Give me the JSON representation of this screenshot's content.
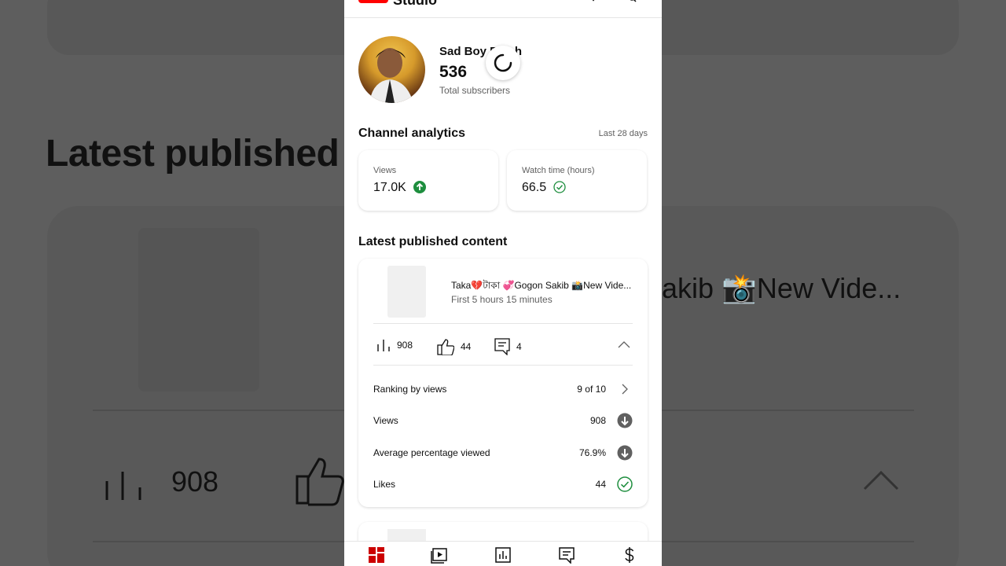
{
  "background": {
    "title": "Latest published",
    "video_title": "akib 📸New Vide...",
    "views": "908"
  },
  "appbar": {
    "brand": "Studio"
  },
  "channel": {
    "name": "Sad Boy R esh",
    "subscribers": "536",
    "subscribers_label": "Total subscribers"
  },
  "analytics": {
    "title": "Channel analytics",
    "period": "Last 28 days",
    "views_label": "Views",
    "views_value": "17.0K",
    "watch_label": "Watch time (hours)",
    "watch_value": "66.5"
  },
  "latest": {
    "title": "Latest published content",
    "video_title": "Taka💔টাকা 💞Gogon Sakib 📸New Vide...",
    "video_subtitle": "First 5 hours 15 minutes",
    "views": "908",
    "likes": "44",
    "comments": "4",
    "rows": [
      {
        "label": "Ranking by views",
        "value": "9 of 10",
        "icon": "chevron-right-icon"
      },
      {
        "label": "Views",
        "value": "908",
        "icon": "arrow-down-circle-icon"
      },
      {
        "label": "Average percentage viewed",
        "value": "76.9%",
        "icon": "arrow-down-circle-icon"
      },
      {
        "label": "Likes",
        "value": "44",
        "icon": "check-circle-icon"
      }
    ]
  },
  "colors": {
    "brand_red": "#ff0000",
    "positive_green": "#1e8e3e",
    "neutral_gray": "#606060"
  },
  "bottom_nav": [
    "dashboard-icon",
    "content-icon",
    "analytics-icon",
    "comments-icon",
    "earn-icon"
  ]
}
